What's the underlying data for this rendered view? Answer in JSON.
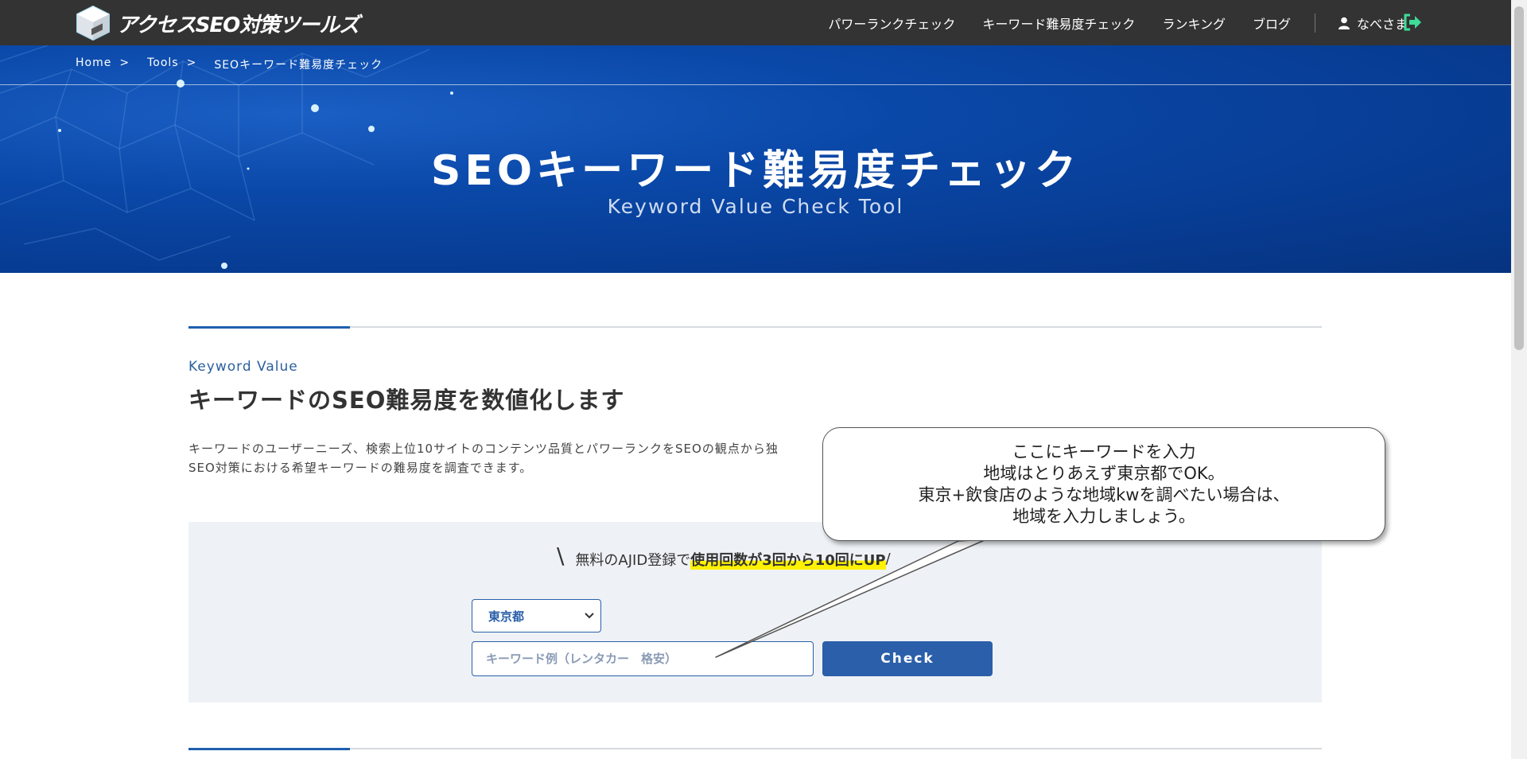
{
  "header": {
    "logo_text": "アクセスSEO対策ツールズ",
    "nav": [
      "パワーランクチェック",
      "キーワード難易度チェック",
      "ランキング",
      "ブログ"
    ],
    "user_name": "なべさま"
  },
  "hero": {
    "breadcrumb": [
      "Home",
      ">",
      "Tools",
      ">",
      "SEOキーワード難易度チェック"
    ],
    "title": "SEOキーワード難易度チェック",
    "subtitle": "Keyword Value Check Tool"
  },
  "section": {
    "eyebrow": "Keyword Value",
    "heading": "キーワードのSEO難易度を数値化します",
    "desc_line1": "キーワードのユーザーニーズ、検索上位10サイトのコンテンツ品質とパワーランクをSEOの観点から独",
    "desc_line2": "SEO対策における希望キーワードの難易度を調査できます。"
  },
  "form": {
    "promo_slash": "\\",
    "promo_prefix": "無料のAJID登録で",
    "promo_highlight": "使用回数が3回から10回にUP",
    "promo_suffix": "/",
    "region_selected": "東京都",
    "keyword_placeholder": "キーワード例（レンタカー　格安）",
    "check_label": "Check"
  },
  "callout": {
    "line1": "ここにキーワードを入力",
    "line2": "地域はとりあえず東京都でOK。",
    "line3": "東京+飲食店のような地域kwを調べたい場合は、",
    "line4": "地域を入力しましょう。"
  },
  "colors": {
    "topbar": "#333333",
    "hero": "#0a48a8",
    "accent": "#2b5faa",
    "highlight": "#fff200",
    "logout": "#3ddc97"
  }
}
